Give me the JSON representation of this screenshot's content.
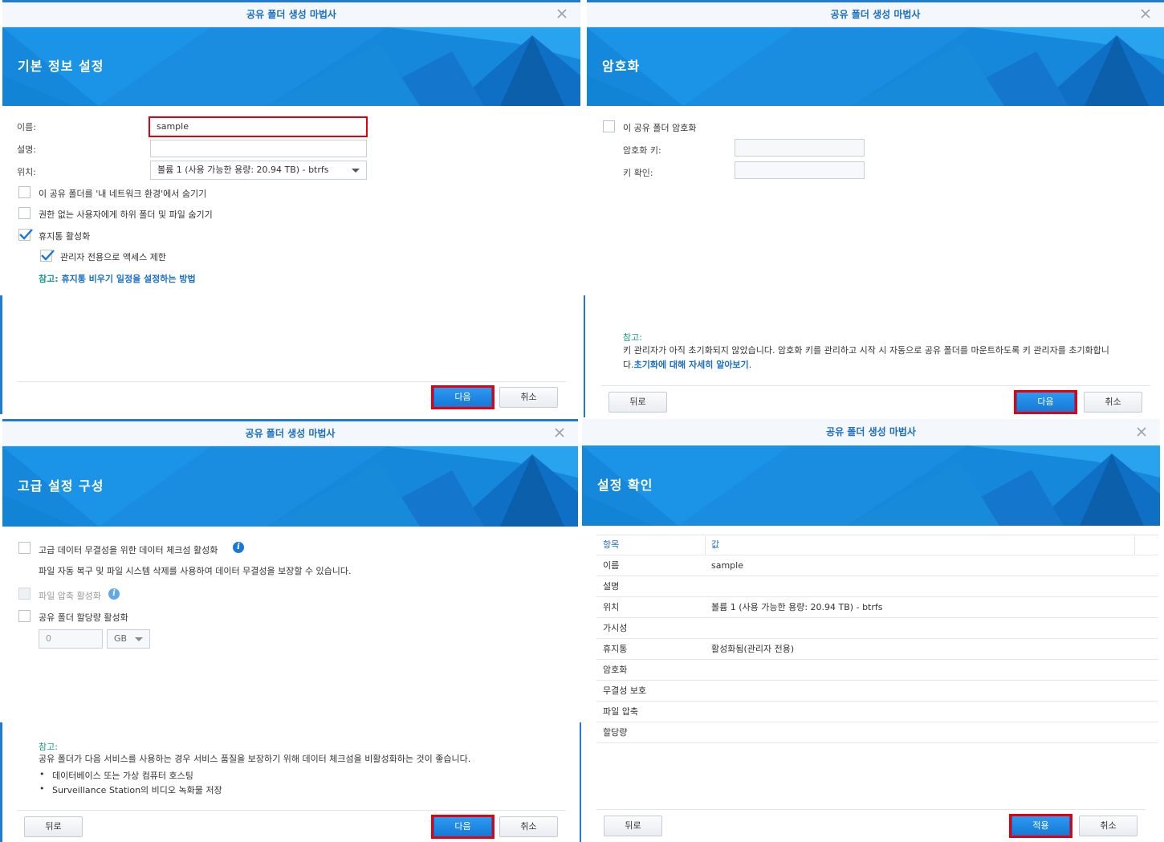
{
  "wizard_title": "공유 폴더 생성 마법사",
  "buttons": {
    "next": "다음",
    "cancel": "취소",
    "back": "뒤로",
    "apply": "적용"
  },
  "step1": {
    "heading": "기본 정보 설정",
    "name_label": "이름:",
    "name_value": "sample",
    "desc_label": "설명:",
    "desc_value": "",
    "location_label": "위치:",
    "location_value": "볼륨 1 (사용 가능한 용량:  20.94 TB) - btrfs",
    "options": [
      {
        "label": "이 공유 폴더를 '내 네트워크 환경'에서 숨기기",
        "checked": false
      },
      {
        "label": "권한 없는 사용자에게 하위 폴더 및 파일 숨기기",
        "checked": false
      },
      {
        "label": "휴지통 활성화",
        "checked": true
      },
      {
        "label": "관리자 전용으로 액세스 제한",
        "checked": true
      }
    ],
    "note_prefix": "참고:",
    "note_link": "휴지통 비우기 일정을 설정하는 방법"
  },
  "step2": {
    "heading": "암호화",
    "encrypt_label": "이 공유 폴더 암호화",
    "encrypt_checked": false,
    "key_label": "암호화 키:",
    "confirm_label": "키 확인:",
    "note_title": "참고:",
    "note_line1": "키 관리자가 아직 초기화되지 않았습니다. 암호화 키를 관리하고 시작 시 자동으로 공유 폴더를 마운트하도록 키 관리자를 초기화합니",
    "note_line2_prefix": "다.",
    "note_link": "초기화에 대해 자세히 알아보기",
    "note_suffix": "."
  },
  "step3": {
    "heading": "고급 설정 구성",
    "checksum_label": "고급 데이터 무결성을 위한 데이터 체크섬 활성화",
    "checksum_desc": "파일 자동 복구 및 파일 시스템 삭제를 사용하여 데이터 무결성을 보장할 수 있습니다.",
    "compress_label": "파일 압축 활성화",
    "quota_label": "공유 폴더 할당량 활성화",
    "quota_value": "0",
    "quota_unit": "GB",
    "note_title": "참고:",
    "note_text": "공유 폴더가 다음 서비스를 사용하는 경우 서비스 품질을 보장하기 위해 데이터 체크섬을 비활성화하는 것이 좋습니다.",
    "note_bullets": [
      "데이터베이스 또는 가상 컴퓨터 호스팅",
      "Surveillance Station의 비디오 녹화물 저장"
    ]
  },
  "step4": {
    "heading": "설정 확인",
    "col_item": "항목",
    "col_value": "값",
    "rows": [
      {
        "k": "이름",
        "v": "sample"
      },
      {
        "k": "설명",
        "v": ""
      },
      {
        "k": "위치",
        "v": "볼륨 1 (사용 가능한 용량: 20.94 TB) - btrfs"
      },
      {
        "k": "가시성",
        "v": ""
      },
      {
        "k": "휴지통",
        "v": "활성화됨(관리자 전용)"
      },
      {
        "k": "암호화",
        "v": ""
      },
      {
        "k": "무결성 보호",
        "v": ""
      },
      {
        "k": "파일 압축",
        "v": ""
      },
      {
        "k": "할당량",
        "v": ""
      }
    ]
  },
  "colors": {
    "accent": "#1a78d6",
    "highlight": "#e4000f",
    "note": "#1a9a8a"
  }
}
